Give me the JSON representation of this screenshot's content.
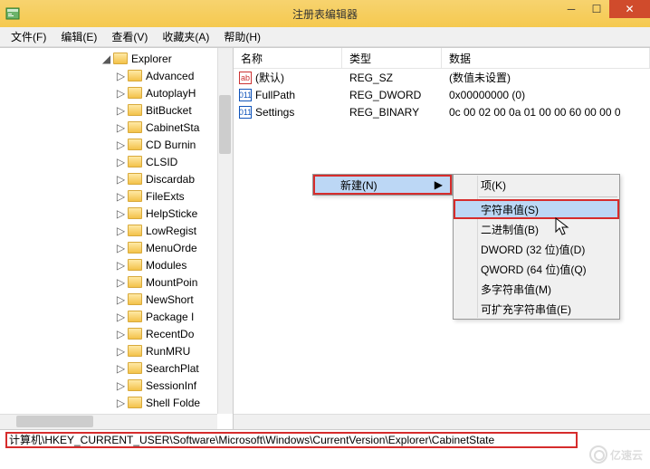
{
  "window": {
    "title": "注册表编辑器"
  },
  "menu": {
    "file": "文件(F)",
    "edit": "编辑(E)",
    "view": "查看(V)",
    "fav": "收藏夹(A)",
    "help": "帮助(H)"
  },
  "tree": {
    "parent": "Explorer",
    "items": [
      "Advanced",
      "AutoplayH",
      "BitBucket",
      "CabinetSta",
      "CD Burnin",
      "CLSID",
      "Discardab",
      "FileExts",
      "HelpSticke",
      "LowRegist",
      "MenuOrde",
      "Modules",
      "MountPoin",
      "NewShort",
      "Package I",
      "RecentDo",
      "RunMRU",
      "SearchPlat",
      "SessionInf",
      "Shell Folde"
    ]
  },
  "list": {
    "headers": {
      "name": "名称",
      "type": "类型",
      "data": "数据"
    },
    "rows": [
      {
        "icon": "str",
        "name": "(默认)",
        "type": "REG_SZ",
        "data": "(数值未设置)"
      },
      {
        "icon": "bin",
        "name": "FullPath",
        "type": "REG_DWORD",
        "data": "0x00000000 (0)"
      },
      {
        "icon": "bin",
        "name": "Settings",
        "type": "REG_BINARY",
        "data": "0c 00 02 00 0a 01 00 00 60 00 00 0"
      }
    ]
  },
  "context": {
    "m1": {
      "new": "新建(N)"
    },
    "m2": {
      "key": "项(K)",
      "string": "字符串值(S)",
      "binary": "二进制值(B)",
      "dword": "DWORD (32 位)值(D)",
      "qword": "QWORD (64 位)值(Q)",
      "multi": "多字符串值(M)",
      "expand": "可扩充字符串值(E)"
    }
  },
  "status": {
    "path": "计算机\\HKEY_CURRENT_USER\\Software\\Microsoft\\Windows\\CurrentVersion\\Explorer\\CabinetState"
  },
  "watermark": "亿速云"
}
